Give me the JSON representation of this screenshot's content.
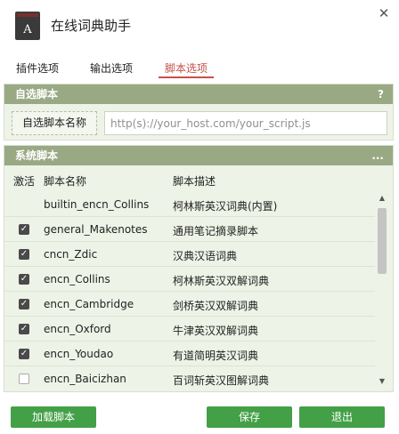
{
  "window": {
    "title": "在线词典助手",
    "close_glyph": "✕"
  },
  "tabs": [
    {
      "label": "插件选项"
    },
    {
      "label": "输出选项"
    },
    {
      "label": "脚本选项"
    }
  ],
  "custom_script": {
    "header": "自选脚本",
    "header_action": "?",
    "name_button": "自选脚本名称",
    "url_placeholder": "http(s)://your_host.com/your_script.js",
    "url_value": ""
  },
  "system_scripts": {
    "header": "系统脚本",
    "header_action": "...",
    "columns": {
      "active": "激活",
      "name": "脚本名称",
      "desc": "脚本描述"
    },
    "rows": [
      {
        "checkbox_visible": false,
        "checked": false,
        "name": "builtin_encn_Collins",
        "desc": "柯林斯英汉词典(内置)"
      },
      {
        "checkbox_visible": true,
        "checked": true,
        "name": "general_Makenotes",
        "desc": "通用笔记摘录脚本"
      },
      {
        "checkbox_visible": true,
        "checked": true,
        "name": "cncn_Zdic",
        "desc": "汉典汉语词典"
      },
      {
        "checkbox_visible": true,
        "checked": true,
        "name": "encn_Collins",
        "desc": "柯林斯英汉双解词典"
      },
      {
        "checkbox_visible": true,
        "checked": true,
        "name": "encn_Cambridge",
        "desc": "剑桥英汉双解词典"
      },
      {
        "checkbox_visible": true,
        "checked": true,
        "name": "encn_Oxford",
        "desc": "牛津英汉双解词典"
      },
      {
        "checkbox_visible": true,
        "checked": true,
        "name": "encn_Youdao",
        "desc": "有道简明英汉词典"
      },
      {
        "checkbox_visible": true,
        "checked": false,
        "name": "encn_Baicizhan",
        "desc": "百词斩英汉图解词典"
      }
    ],
    "scroll_up_glyph": "▲",
    "scroll_down_glyph": "▼"
  },
  "buttons": {
    "load": "加载脚本",
    "save": "保存",
    "exit": "退出"
  },
  "colors": {
    "panel_header": "#99a984",
    "panel_bg": "#eef3e7",
    "active_tab": "#c5524a",
    "button": "#43a047"
  },
  "icons": {
    "app": "dictionary-book-icon",
    "checkbox_checked": "checkmark-icon"
  }
}
